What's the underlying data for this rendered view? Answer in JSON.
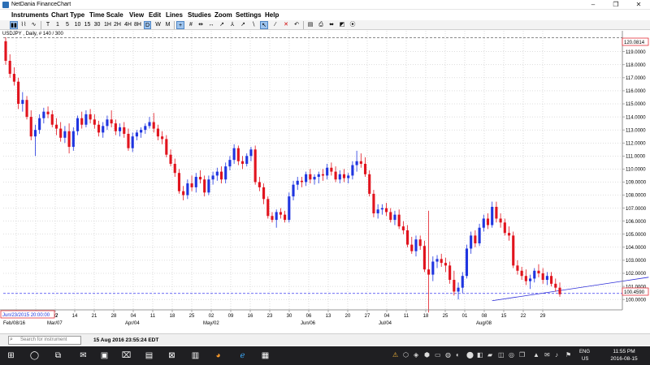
{
  "window": {
    "title": "NetDania FinanceChart",
    "minimize": "–",
    "restore": "❐",
    "close": "✕"
  },
  "menu": [
    "Instruments",
    "Chart Type",
    "Time Scale",
    "View",
    "Edit",
    "Lines",
    "Studies",
    "Zoom",
    "Settings",
    "Help"
  ],
  "toolbar": {
    "chart_type_buttons": [
      "▮▮",
      "⌇⌇",
      "∿"
    ],
    "timescale_buttons": [
      "T",
      "1",
      "5",
      "10",
      "15",
      "30",
      "1H",
      "2H",
      "4H",
      "8H",
      "D",
      "W",
      "M"
    ],
    "selected_timescale": "D",
    "tool_buttons": [
      "+",
      "#",
      "⇹",
      "↔",
      "↗",
      "⅄",
      "↗",
      "∖",
      "⤳",
      "↖",
      "⁄",
      "✕",
      "↶",
      "▤",
      "⎙",
      "⬌",
      "◩",
      "⦿"
    ]
  },
  "chart": {
    "instrument_caption": "USDJPY , Daily, # 140 / 300",
    "cursor_label": "Jun/23/2015 20:00:00",
    "top_price_label": "120.0814",
    "current_price_label": "100.4590"
  },
  "status": {
    "search_placeholder": "Search for instrument",
    "timestamp": "15 Aug 2016 23:55:24 EDT"
  },
  "taskbar": {
    "apps": [
      "⊞",
      "◯",
      "⧉",
      "✉",
      "▣",
      "⌧",
      "▤",
      "⊠",
      "▥",
      "◕",
      "ℯ",
      "▦"
    ],
    "tray_icons": [
      "⚠",
      "⬡",
      "◈",
      "⬢",
      "▭",
      "◍",
      "◐",
      "⬤",
      "◧",
      "▰",
      "◫",
      "◎",
      "❒",
      "▲",
      "✉",
      "♪",
      "⚑"
    ],
    "lang_line1": "ENG",
    "lang_line2": "US",
    "time": "11:55 PM",
    "date": "2016-08-15",
    "colors": {
      "taskbar_bg": "#1f1f22"
    }
  },
  "chart_data": {
    "type": "candlestick",
    "instrument": "USDJPY",
    "interval": "Daily",
    "colors": {
      "up": "#1f35e0",
      "down": "#e1141e",
      "grid": "#bdbdbd",
      "dashed_line": "#3a3af0"
    },
    "y_ticks": [
      "119.0000",
      "118.0000",
      "117.0000",
      "116.0000",
      "115.0000",
      "114.0000",
      "113.0000",
      "112.0000",
      "111.0000",
      "110.0000",
      "109.0000",
      "108.0000",
      "107.0000",
      "106.0000",
      "105.0000",
      "104.0000",
      "103.0000",
      "102.0000",
      "101.0000",
      "100.0000"
    ],
    "ylim": [
      99.2,
      120.6
    ],
    "top_line_value": 120.0814,
    "current_value": 100.459,
    "x_ticks": [
      "22",
      "29",
      "07",
      "14",
      "21",
      "28",
      "04",
      "11",
      "18",
      "25",
      "02",
      "09",
      "16",
      "23",
      "30",
      "06",
      "13",
      "20",
      "27",
      "04",
      "11",
      "18",
      "25",
      "01",
      "08",
      "15",
      "22",
      "29"
    ],
    "x_month_labels": [
      {
        "after_tick": 0,
        "label": "Feb/08/16"
      },
      {
        "after_tick": 2,
        "label": "Mar/07"
      },
      {
        "after_tick": 6,
        "label": "Apr/04"
      },
      {
        "after_tick": 10,
        "label": "May/02"
      },
      {
        "after_tick": 15,
        "label": "Jun/06"
      },
      {
        "after_tick": 19,
        "label": "Jul/04"
      },
      {
        "after_tick": 24,
        "label": "Aug/08"
      }
    ],
    "trendline": {
      "start_index": 115,
      "start_value": 99.9,
      "end_index": 152,
      "end_value": 101.7
    },
    "candles": [
      [
        119.8,
        120.1,
        118.0,
        118.3
      ],
      [
        118.3,
        118.8,
        117.0,
        117.3
      ],
      [
        117.3,
        117.8,
        116.4,
        116.7
      ],
      [
        116.7,
        117.0,
        114.6,
        115.0
      ],
      [
        115.0,
        115.9,
        114.4,
        115.3
      ],
      [
        115.3,
        115.6,
        113.8,
        114.0
      ],
      [
        114.0,
        114.5,
        112.2,
        112.5
      ],
      [
        112.5,
        113.4,
        111.0,
        113.0
      ],
      [
        113.0,
        114.2,
        112.7,
        113.9
      ],
      [
        113.9,
        114.7,
        113.5,
        114.4
      ],
      [
        114.4,
        114.8,
        113.9,
        114.2
      ],
      [
        114.2,
        114.5,
        113.2,
        113.4
      ],
      [
        113.4,
        113.9,
        112.6,
        113.1
      ],
      [
        113.1,
        113.6,
        112.1,
        112.4
      ],
      [
        112.4,
        113.3,
        112.0,
        112.9
      ],
      [
        112.9,
        113.5,
        111.2,
        111.7
      ],
      [
        111.7,
        113.2,
        111.4,
        112.9
      ],
      [
        112.9,
        114.1,
        112.6,
        113.9
      ],
      [
        113.9,
        114.4,
        113.1,
        113.4
      ],
      [
        113.4,
        114.5,
        113.2,
        114.2
      ],
      [
        114.2,
        114.6,
        113.5,
        113.8
      ],
      [
        113.8,
        114.2,
        113.1,
        113.4
      ],
      [
        113.4,
        113.7,
        112.5,
        112.8
      ],
      [
        112.8,
        113.6,
        112.4,
        113.3
      ],
      [
        113.3,
        114.1,
        113.0,
        113.8
      ],
      [
        113.8,
        114.5,
        113.2,
        113.5
      ],
      [
        113.5,
        113.8,
        112.6,
        112.9
      ],
      [
        112.9,
        113.5,
        112.5,
        113.2
      ],
      [
        113.2,
        113.6,
        112.4,
        112.7
      ],
      [
        112.7,
        113.1,
        111.4,
        111.6
      ],
      [
        111.6,
        112.8,
        111.3,
        112.5
      ],
      [
        112.5,
        113.0,
        112.2,
        112.8
      ],
      [
        112.8,
        113.2,
        112.4,
        113.0
      ],
      [
        113.0,
        113.5,
        112.7,
        113.3
      ],
      [
        113.3,
        114.0,
        113.1,
        113.6
      ],
      [
        113.6,
        114.3,
        112.8,
        113.1
      ],
      [
        113.1,
        113.4,
        112.2,
        112.5
      ],
      [
        112.5,
        112.9,
        111.9,
        112.3
      ],
      [
        112.3,
        112.6,
        110.9,
        111.1
      ],
      [
        111.1,
        111.5,
        110.2,
        110.4
      ],
      [
        110.4,
        110.8,
        109.4,
        109.7
      ],
      [
        109.7,
        110.0,
        108.1,
        108.3
      ],
      [
        108.3,
        108.7,
        107.6,
        108.0
      ],
      [
        108.0,
        109.2,
        107.7,
        108.9
      ],
      [
        108.9,
        109.5,
        108.3,
        108.6
      ],
      [
        108.6,
        109.7,
        108.2,
        109.4
      ],
      [
        109.4,
        109.9,
        108.9,
        109.2
      ],
      [
        109.2,
        109.5,
        107.9,
        108.2
      ],
      [
        108.2,
        109.5,
        108.0,
        109.2
      ],
      [
        109.2,
        109.8,
        108.8,
        109.5
      ],
      [
        109.5,
        110.1,
        109.1,
        109.8
      ],
      [
        109.8,
        110.2,
        108.9,
        109.2
      ],
      [
        109.2,
        110.5,
        108.9,
        110.2
      ],
      [
        110.2,
        111.0,
        109.9,
        110.7
      ],
      [
        110.7,
        111.9,
        110.4,
        111.6
      ],
      [
        111.6,
        111.8,
        110.3,
        110.6
      ],
      [
        110.6,
        111.0,
        110.0,
        110.4
      ],
      [
        110.4,
        111.2,
        110.2,
        111.0
      ],
      [
        111.0,
        111.7,
        110.6,
        111.5
      ],
      [
        111.5,
        111.8,
        108.8,
        109.0
      ],
      [
        109.0,
        109.4,
        108.3,
        108.6
      ],
      [
        108.6,
        108.9,
        107.3,
        107.7
      ],
      [
        107.7,
        107.9,
        106.2,
        106.4
      ],
      [
        106.4,
        106.7,
        105.9,
        106.1
      ],
      [
        106.1,
        106.9,
        105.5,
        106.7
      ],
      [
        106.7,
        107.0,
        106.2,
        106.5
      ],
      [
        106.5,
        106.8,
        105.9,
        106.1
      ],
      [
        106.1,
        108.2,
        105.9,
        107.9
      ],
      [
        107.9,
        109.1,
        107.6,
        108.8
      ],
      [
        108.8,
        109.4,
        108.4,
        109.1
      ],
      [
        109.1,
        109.4,
        108.6,
        109.0
      ],
      [
        109.0,
        109.8,
        108.7,
        109.6
      ],
      [
        109.6,
        110.0,
        108.9,
        109.2
      ],
      [
        109.2,
        109.6,
        108.8,
        109.4
      ],
      [
        109.4,
        109.8,
        108.9,
        109.6
      ],
      [
        109.6,
        110.0,
        109.1,
        109.5
      ],
      [
        109.5,
        110.4,
        109.2,
        110.1
      ],
      [
        110.1,
        110.5,
        109.5,
        109.8
      ],
      [
        109.8,
        110.2,
        109.0,
        109.2
      ],
      [
        109.2,
        109.9,
        108.9,
        109.6
      ],
      [
        109.6,
        110.0,
        109.0,
        109.3
      ],
      [
        109.3,
        109.7,
        108.9,
        109.5
      ],
      [
        109.5,
        110.6,
        109.2,
        110.3
      ],
      [
        110.3,
        111.4,
        109.8,
        110.6
      ],
      [
        110.6,
        111.2,
        110.1,
        110.4
      ],
      [
        110.4,
        110.9,
        109.4,
        109.6
      ],
      [
        109.6,
        109.9,
        107.9,
        108.1
      ],
      [
        108.1,
        108.4,
        106.3,
        106.6
      ],
      [
        106.6,
        107.3,
        106.2,
        106.9
      ],
      [
        106.9,
        107.3,
        106.5,
        107.0
      ],
      [
        107.0,
        107.4,
        106.4,
        106.7
      ],
      [
        106.7,
        107.0,
        105.9,
        106.1
      ],
      [
        106.1,
        106.8,
        105.7,
        106.5
      ],
      [
        106.5,
        106.9,
        105.4,
        105.6
      ],
      [
        105.6,
        106.0,
        105.0,
        105.3
      ],
      [
        105.3,
        105.7,
        104.0,
        104.2
      ],
      [
        104.2,
        104.8,
        103.5,
        103.7
      ],
      [
        103.7,
        104.9,
        103.3,
        104.6
      ],
      [
        104.6,
        104.9,
        103.8,
        104.1
      ],
      [
        104.1,
        104.5,
        102.1,
        102.3
      ],
      [
        102.3,
        106.8,
        99.0,
        101.9
      ],
      [
        101.9,
        103.3,
        101.4,
        102.9
      ],
      [
        102.9,
        103.4,
        102.4,
        103.1
      ],
      [
        103.1,
        103.5,
        102.5,
        102.8
      ],
      [
        102.8,
        103.2,
        102.1,
        102.6
      ],
      [
        102.6,
        102.9,
        101.2,
        101.5
      ],
      [
        101.5,
        102.2,
        100.3,
        100.6
      ],
      [
        100.6,
        101.3,
        100.0,
        100.9
      ],
      [
        100.9,
        102.1,
        100.5,
        101.8
      ],
      [
        101.8,
        104.2,
        101.6,
        103.9
      ],
      [
        103.9,
        105.2,
        103.5,
        104.9
      ],
      [
        104.9,
        105.3,
        104.0,
        104.3
      ],
      [
        104.3,
        105.8,
        104.1,
        105.5
      ],
      [
        105.5,
        106.5,
        105.2,
        106.2
      ],
      [
        106.2,
        106.6,
        105.4,
        105.7
      ],
      [
        105.7,
        107.5,
        105.5,
        107.1
      ],
      [
        107.1,
        107.5,
        105.9,
        106.2
      ],
      [
        106.2,
        106.6,
        105.5,
        105.9
      ],
      [
        105.9,
        106.2,
        104.9,
        105.1
      ],
      [
        105.1,
        105.6,
        104.5,
        104.9
      ],
      [
        104.9,
        105.2,
        102.4,
        102.6
      ],
      [
        102.6,
        103.0,
        101.9,
        102.2
      ],
      [
        102.2,
        102.5,
        101.5,
        101.8
      ],
      [
        101.8,
        102.3,
        101.1,
        101.4
      ],
      [
        101.4,
        101.9,
        100.8,
        101.6
      ],
      [
        101.6,
        102.4,
        101.3,
        102.2
      ],
      [
        102.2,
        102.7,
        101.7,
        102.0
      ],
      [
        102.0,
        102.4,
        101.2,
        101.5
      ],
      [
        101.5,
        102.1,
        101.1,
        101.8
      ],
      [
        101.8,
        102.1,
        101.0,
        101.2
      ],
      [
        101.2,
        101.6,
        100.6,
        100.9
      ],
      [
        100.9,
        101.3,
        100.2,
        100.4
      ]
    ]
  }
}
